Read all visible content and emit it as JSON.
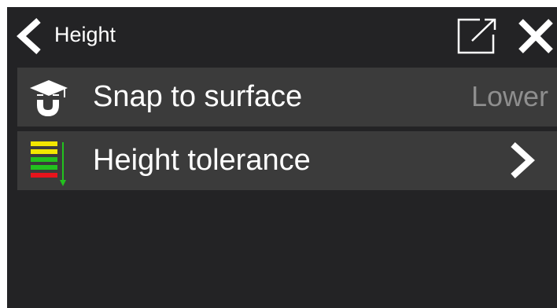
{
  "header": {
    "title": "Height",
    "back_icon": "chevron-left-icon",
    "popout_icon": "open-external-icon",
    "close_icon": "close-icon"
  },
  "settings": [
    {
      "label": "Snap to surface",
      "value": "Lower",
      "icon": "mortarboard-magnet-icon"
    },
    {
      "label": "Height tolerance",
      "icon": "height-levels-icon",
      "trailing_icon": "chevron-right-icon"
    }
  ],
  "colors": {
    "panel_background": "#232325",
    "row_background": "#3b3b3b",
    "text": "#ffffff",
    "value_text": "#8e8e8e",
    "level_yellow": "#f2e600",
    "level_green": "#22c21e",
    "level_red": "#e8141c"
  }
}
